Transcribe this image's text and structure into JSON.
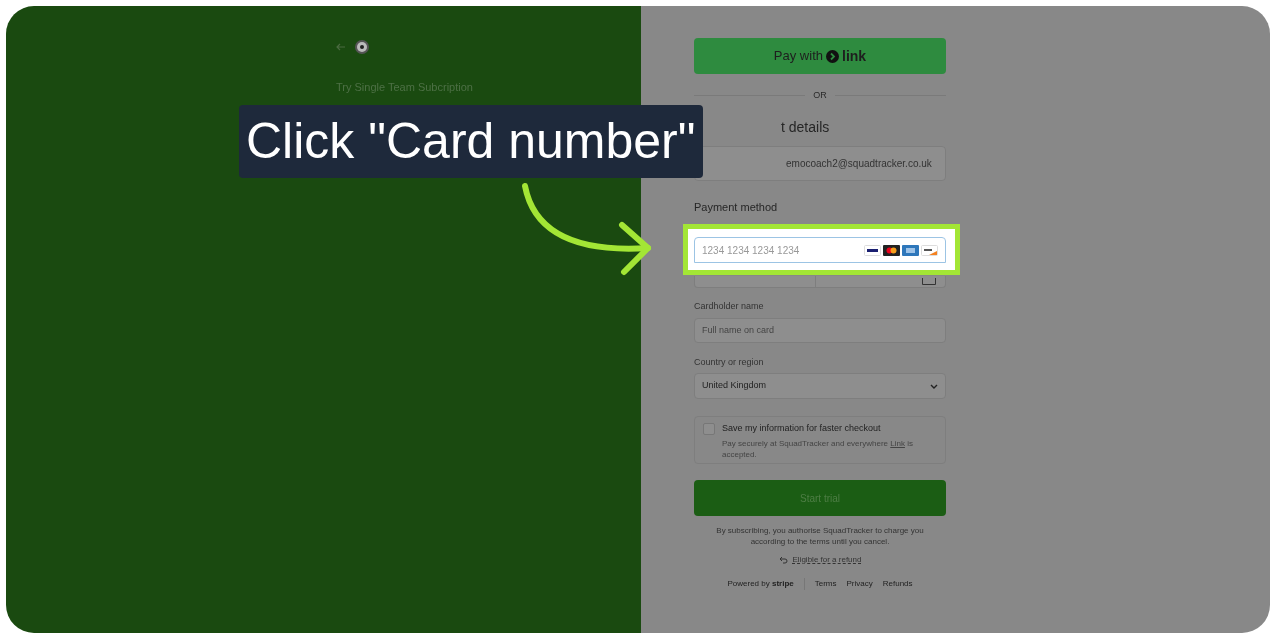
{
  "left_panel": {
    "subtitle": "Try Single Team Subcription"
  },
  "callout": {
    "text": "Click \"Card number\""
  },
  "checkout": {
    "pay_button": {
      "label": "Pay with",
      "brand": "link"
    },
    "divider": "OR",
    "contact_heading": "t details",
    "email": "emocoach2@squadtracker.co.uk",
    "payment_heading": "Payment method",
    "card_number": {
      "placeholder": "1234 1234 1234 1234",
      "highlighted": true
    },
    "cardholder": {
      "label": "Cardholder name",
      "placeholder": "Full name on card"
    },
    "country": {
      "label": "Country or region",
      "value": "United Kingdom"
    },
    "save_info": {
      "checked": false,
      "label": "Save my information for faster checkout",
      "description_before": "Pay securely at SquadTracker and everywhere",
      "link": "Link",
      "description_after": "is accepted."
    },
    "submit": {
      "label": "Start trial"
    },
    "terms": "By subscribing, you authorise SquadTracker to charge you according to the terms until you cancel.",
    "refund_link": "Eligible for a refund",
    "footer": {
      "powered_by": "Powered by",
      "brand": "stripe",
      "links": [
        "Terms",
        "Privacy",
        "Refunds"
      ]
    }
  }
}
